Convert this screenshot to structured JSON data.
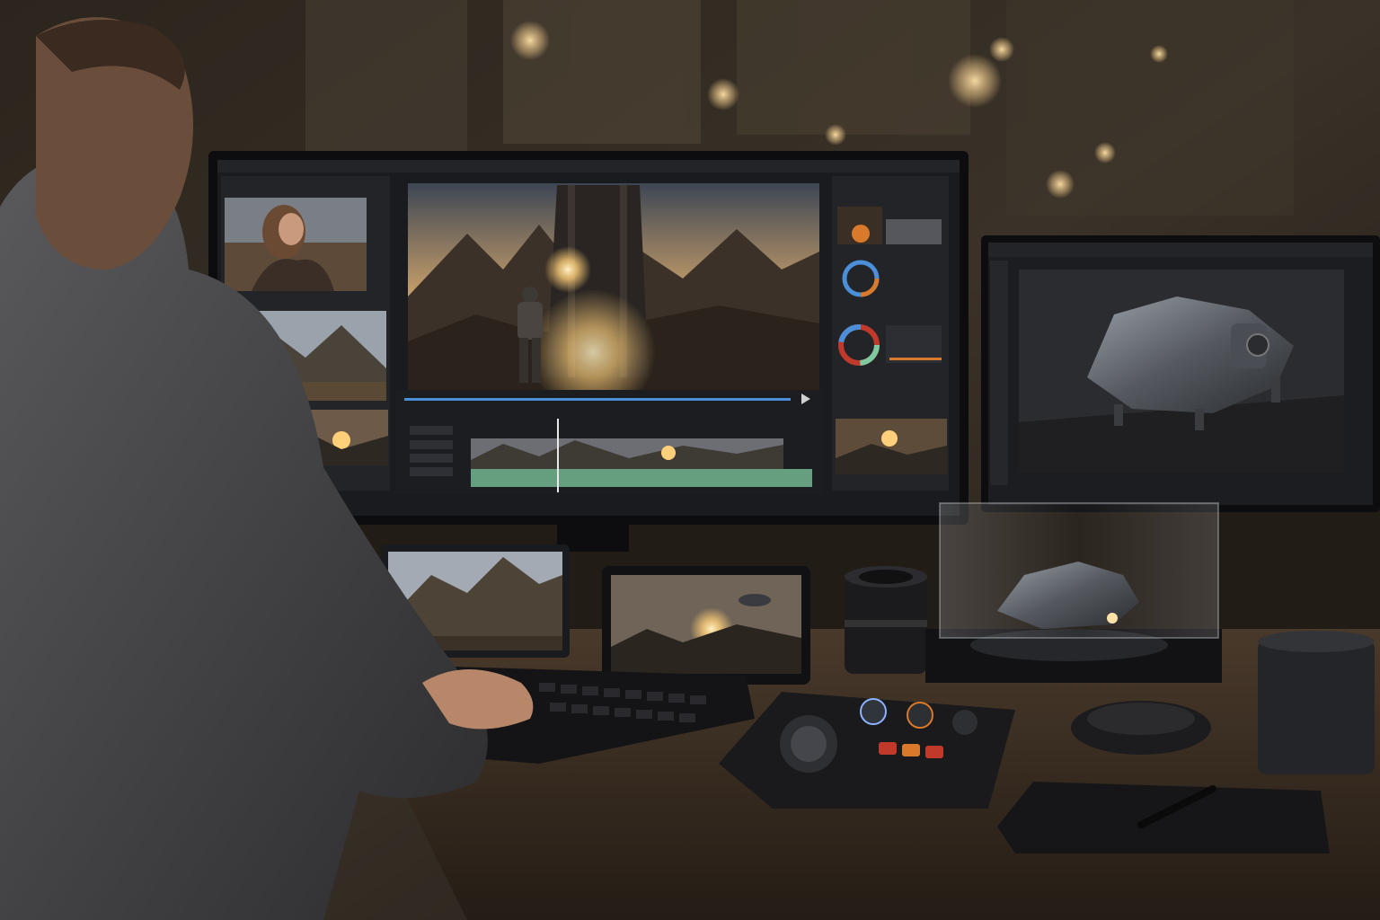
{
  "scene": {
    "kind": "photograph",
    "subject": "video-editing-workstation"
  },
  "palette": {
    "background_dark": "#16130f",
    "bokeh_warm": "#f0c98a",
    "monitor_bezel": "#0d0d0f",
    "ui_panel": "#232428",
    "ui_panel_dark": "#1a1b1e",
    "timeline_green": "#7fc9a0",
    "accent_blue": "#4a8fd8",
    "sunlight": "#ffcf7a",
    "desk_wood": "#3b2e22",
    "shirt_gray": "#4a4a4c",
    "skin": "#b8876a",
    "button_red": "#c0392b",
    "button_orange": "#d9792b"
  },
  "icons": {
    "play": "play-icon",
    "pause": "pause-icon",
    "color_wheel": "color-wheel-icon"
  }
}
